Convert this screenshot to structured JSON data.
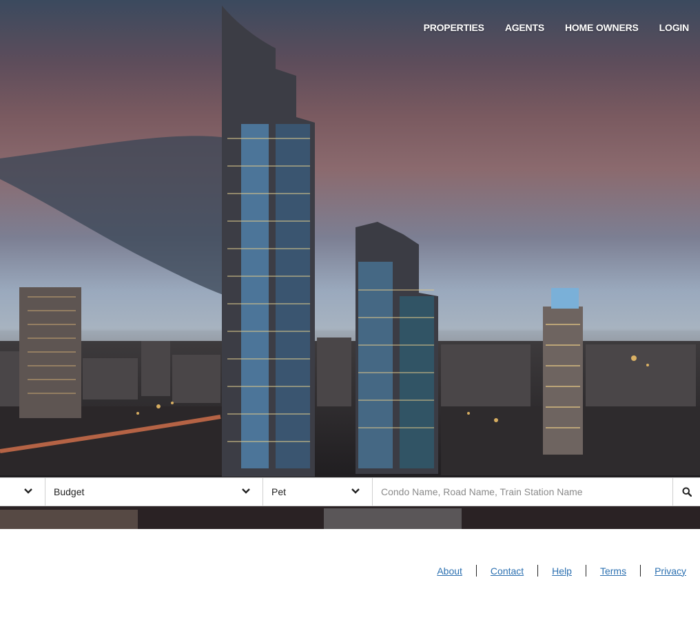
{
  "nav": {
    "items": [
      "PROPERTIES",
      "AGENTS",
      "HOME OWNERS",
      "LOGIN"
    ]
  },
  "search": {
    "location_label": "",
    "budget_label": "Budget",
    "pet_label": "Pet",
    "query_placeholder": "Condo Name, Road Name, Train Station Name",
    "query_value": ""
  },
  "footer": {
    "links": [
      "About",
      "Contact",
      "Help",
      "Terms",
      "Privacy"
    ]
  },
  "icons": {
    "chevron": "chevron-down-icon",
    "search": "search-icon"
  },
  "colors": {
    "link": "#2a6fb0",
    "nav_text": "#ffffff"
  }
}
